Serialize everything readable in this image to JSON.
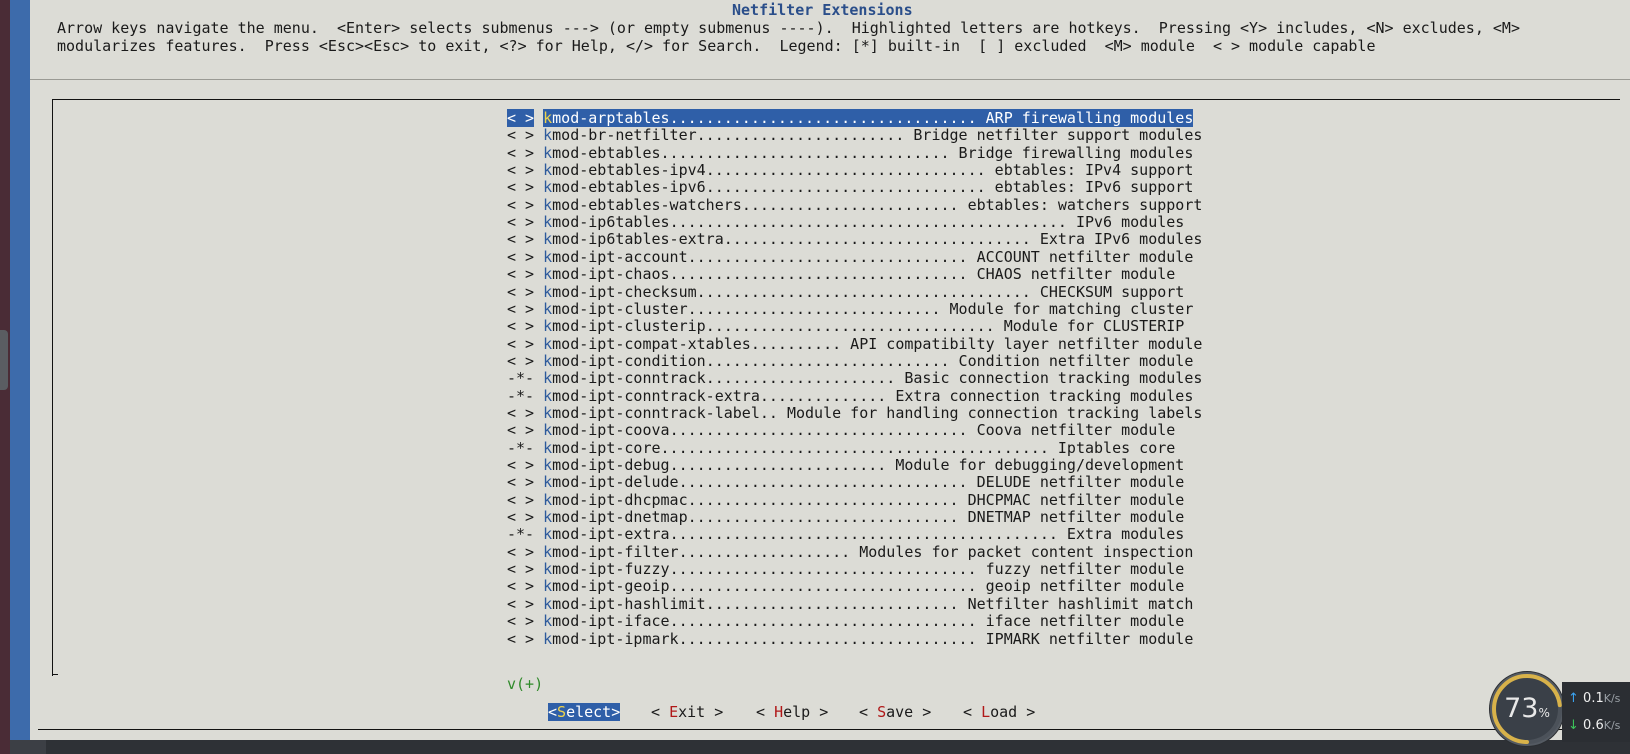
{
  "terminal": {
    "title": "Netfilter Extensions",
    "help_line_1": "Arrow keys navigate the menu.  <Enter> selects submenus ---> (or empty submenus ----).  Highlighted letters are hotkeys.  Pressing <Y> includes, <N> excludes, <M>",
    "help_line_2": "modularizes features.  Press <Esc><Esc> to exit, <?> for Help, </> for Search.  Legend: [*] built-in  [ ] excluded  <M> module  < > module capable"
  },
  "menu": {
    "items": [
      {
        "state": "< >",
        "hotkey": "k",
        "name": "mod-arptables",
        "filler": "..................................",
        "prompt": " ARP firewalling modules",
        "selected": true
      },
      {
        "state": "< >",
        "hotkey": "k",
        "name": "mod-br-netfilter",
        "filler": ".......................",
        "prompt": " Bridge netfilter support modules"
      },
      {
        "state": "< >",
        "hotkey": "k",
        "name": "mod-ebtables",
        "filler": "................................",
        "prompt": " Bridge firewalling modules"
      },
      {
        "state": "< >",
        "hotkey": "k",
        "name": "mod-ebtables-ipv4",
        "filler": "...............................",
        "prompt": " ebtables: IPv4 support"
      },
      {
        "state": "< >",
        "hotkey": "k",
        "name": "mod-ebtables-ipv6",
        "filler": "...............................",
        "prompt": " ebtables: IPv6 support"
      },
      {
        "state": "< >",
        "hotkey": "k",
        "name": "mod-ebtables-watchers",
        "filler": "........................",
        "prompt": " ebtables: watchers support"
      },
      {
        "state": "< >",
        "hotkey": "k",
        "name": "mod-ip6tables",
        "filler": "............................................",
        "prompt": " IPv6 modules"
      },
      {
        "state": "< >",
        "hotkey": "k",
        "name": "mod-ip6tables-extra",
        "filler": "..................................",
        "prompt": " Extra IPv6 modules"
      },
      {
        "state": "< >",
        "hotkey": "k",
        "name": "mod-ipt-account",
        "filler": "...............................",
        "prompt": " ACCOUNT netfilter module"
      },
      {
        "state": "< >",
        "hotkey": "k",
        "name": "mod-ipt-chaos",
        "filler": ".................................",
        "prompt": " CHAOS netfilter module"
      },
      {
        "state": "< >",
        "hotkey": "k",
        "name": "mod-ipt-checksum",
        "filler": ".....................................",
        "prompt": " CHECKSUM support"
      },
      {
        "state": "< >",
        "hotkey": "k",
        "name": "mod-ipt-cluster",
        "filler": "............................",
        "prompt": " Module for matching cluster"
      },
      {
        "state": "< >",
        "hotkey": "k",
        "name": "mod-ipt-clusterip",
        "filler": "................................",
        "prompt": " Module for CLUSTERIP"
      },
      {
        "state": "< >",
        "hotkey": "k",
        "name": "mod-ipt-compat-xtables",
        "filler": "..........",
        "prompt": " API compatibilty layer netfilter module"
      },
      {
        "state": "< >",
        "hotkey": "k",
        "name": "mod-ipt-condition",
        "filler": "...........................",
        "prompt": " Condition netfilter module"
      },
      {
        "state": "-*-",
        "hotkey": "k",
        "name": "mod-ipt-conntrack",
        "filler": ".....................",
        "prompt": " Basic connection tracking modules"
      },
      {
        "state": "-*-",
        "hotkey": "k",
        "name": "mod-ipt-conntrack-extra",
        "filler": "..............",
        "prompt": " Extra connection tracking modules"
      },
      {
        "state": "< >",
        "hotkey": "k",
        "name": "mod-ipt-conntrack-label",
        "filler": "..",
        "prompt": " Module for handling connection tracking labels"
      },
      {
        "state": "< >",
        "hotkey": "k",
        "name": "mod-ipt-coova",
        "filler": ".................................",
        "prompt": " Coova netfilter module"
      },
      {
        "state": "-*-",
        "hotkey": "k",
        "name": "mod-ipt-core",
        "filler": "...........................................",
        "prompt": " Iptables core"
      },
      {
        "state": "< >",
        "hotkey": "k",
        "name": "mod-ipt-debug",
        "filler": "........................",
        "prompt": " Module for debugging/development"
      },
      {
        "state": "< >",
        "hotkey": "k",
        "name": "mod-ipt-delude",
        "filler": "................................",
        "prompt": " DELUDE netfilter module"
      },
      {
        "state": "< >",
        "hotkey": "k",
        "name": "mod-ipt-dhcpmac",
        "filler": "..............................",
        "prompt": " DHCPMAC netfilter module"
      },
      {
        "state": "< >",
        "hotkey": "k",
        "name": "mod-ipt-dnetmap",
        "filler": "..............................",
        "prompt": " DNETMAP netfilter module"
      },
      {
        "state": "-*-",
        "hotkey": "k",
        "name": "mod-ipt-extra",
        "filler": "...........................................",
        "prompt": " Extra modules"
      },
      {
        "state": "< >",
        "hotkey": "k",
        "name": "mod-ipt-filter",
        "filler": "...................",
        "prompt": " Modules for packet content inspection"
      },
      {
        "state": "< >",
        "hotkey": "k",
        "name": "mod-ipt-fuzzy",
        "filler": "..................................",
        "prompt": " fuzzy netfilter module"
      },
      {
        "state": "< >",
        "hotkey": "k",
        "name": "mod-ipt-geoip",
        "filler": "..................................",
        "prompt": " geoip netfilter module"
      },
      {
        "state": "< >",
        "hotkey": "k",
        "name": "mod-ipt-hashlimit",
        "filler": "............................",
        "prompt": " Netfilter hashlimit match"
      },
      {
        "state": "< >",
        "hotkey": "k",
        "name": "mod-ipt-iface",
        "filler": "..................................",
        "prompt": " iface netfilter module"
      },
      {
        "state": "< >",
        "hotkey": "k",
        "name": "mod-ipt-ipmark",
        "filler": ".................................",
        "prompt": " IPMARK netfilter module"
      }
    ],
    "more_indicator": "v(+)"
  },
  "buttons": [
    {
      "pre": "<",
      "hotkey": "S",
      "rest": "elect>",
      "active": true
    },
    {
      "pre": "< ",
      "hotkey": "E",
      "rest": "xit >",
      "active": false
    },
    {
      "pre": "< ",
      "hotkey": "H",
      "rest": "elp >",
      "active": false
    },
    {
      "pre": "< ",
      "hotkey": "S",
      "rest": "ave >",
      "active": false
    },
    {
      "pre": "< ",
      "hotkey": "L",
      "rest": "oad >",
      "active": false
    }
  ],
  "net_monitor": {
    "percent": "73",
    "percent_sign": "%",
    "percent_value": 0.73,
    "upload_value": "0.1",
    "upload_unit": "K/s",
    "download_value": "0.6",
    "download_unit": "K/s"
  }
}
